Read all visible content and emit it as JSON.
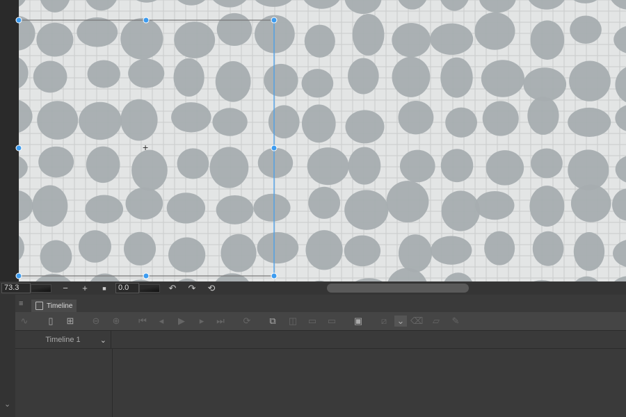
{
  "canvas": {
    "zoom_value": "73.3",
    "rotation_value": "0.0",
    "accent": "#3d9cf0"
  },
  "bottom_bar": {
    "zoom_out": "−",
    "zoom_in": "+",
    "stop": "■",
    "undo": "↶",
    "redo": "↷",
    "reset": "⟲"
  },
  "panel": {
    "tab_label": "Timeline",
    "menu_icon": "≡",
    "collapse_icon": "⌄"
  },
  "timeline": {
    "name": "Timeline 1",
    "dropdown": "⌄"
  }
}
